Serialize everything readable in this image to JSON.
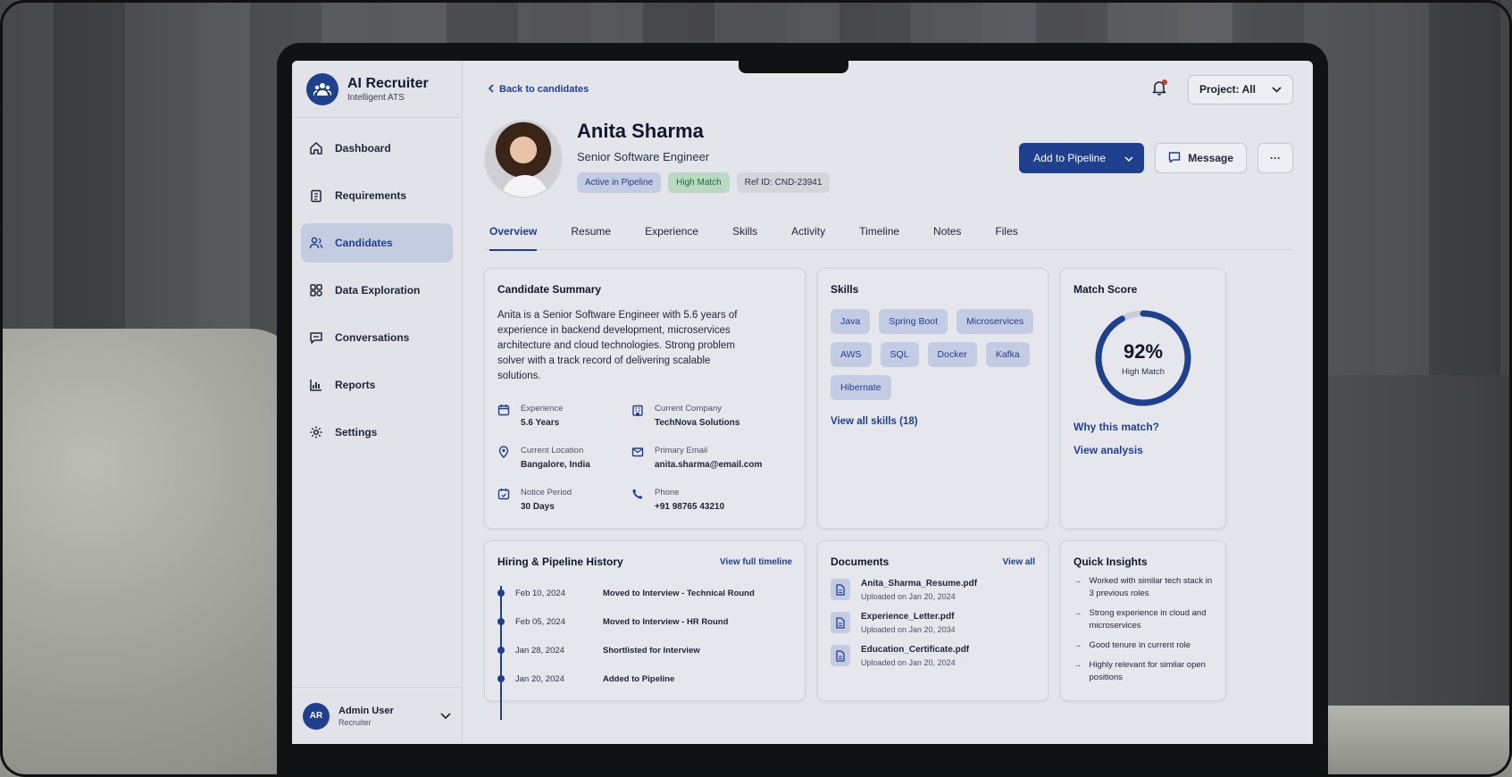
{
  "app": {
    "name": "AI Recruiter",
    "subtitle": "Intelligent ATS"
  },
  "sidebar": {
    "items": [
      {
        "label": "Dashboard",
        "icon": "home-icon"
      },
      {
        "label": "Requirements",
        "icon": "clipboard-icon"
      },
      {
        "label": "Candidates",
        "icon": "users-icon",
        "active": true
      },
      {
        "label": "Data Exploration",
        "icon": "explore-icon"
      },
      {
        "label": "Conversations",
        "icon": "chat-icon"
      },
      {
        "label": "Reports",
        "icon": "bar-chart-icon"
      },
      {
        "label": "Settings",
        "icon": "gear-icon"
      }
    ],
    "user": {
      "initials": "AR",
      "name": "Admin User",
      "role": "Recruiter"
    }
  },
  "topbar": {
    "back_label": "Back to candidates",
    "project_label": "Project: All"
  },
  "candidate": {
    "name": "Anita Sharma",
    "title": "Senior Software Engineer",
    "badges": {
      "pipeline": "Active in Pipeline",
      "match": "High Match",
      "ref": "Ref ID: CND-23941"
    },
    "actions": {
      "add_pipeline": "Add to Pipeline",
      "message": "Message",
      "more": "···"
    }
  },
  "tabs": [
    "Overview",
    "Resume",
    "Experience",
    "Skills",
    "Activity",
    "Timeline",
    "Notes",
    "Files"
  ],
  "summary": {
    "title": "Candidate Summary",
    "text": "Anita is a Senior Software Engineer with 5.6 years of experience in backend development, microservices architecture and cloud technologies. Strong problem solver with a track record of delivering scalable solutions.",
    "facts": [
      {
        "label": "Experience",
        "value": "5.6 Years",
        "icon": "calendar-icon"
      },
      {
        "label": "Current Company",
        "value": "TechNova Solutions",
        "icon": "building-icon"
      },
      {
        "label": "Current Location",
        "value": "Bangalore, India",
        "icon": "location-pin-icon"
      },
      {
        "label": "Primary Email",
        "value": "anita.sharma@email.com",
        "icon": "mail-icon"
      },
      {
        "label": "Notice Period",
        "value": "30 Days",
        "icon": "clock-calendar-icon"
      },
      {
        "label": "Phone",
        "value": "+91 98765 43210",
        "icon": "phone-icon"
      }
    ]
  },
  "skills": {
    "title": "Skills",
    "items": [
      "Java",
      "Spring Boot",
      "Microservices",
      "AWS",
      "SQL",
      "Docker",
      "Kafka",
      "Hibernate"
    ],
    "view_all": "View all skills (18)"
  },
  "match": {
    "title": "Match Score",
    "percent": 92,
    "percent_label": "92%",
    "label": "High Match",
    "why": "Why this match?",
    "analysis": "View analysis",
    "color": "#1f3f8f"
  },
  "history": {
    "title": "Hiring & Pipeline History",
    "link": "View full timeline",
    "events": [
      {
        "date": "Feb 10, 2024",
        "event": "Moved to Interview - Technical Round"
      },
      {
        "date": "Feb 05, 2024",
        "event": "Moved to Interview - HR Round"
      },
      {
        "date": "Jan 28, 2024",
        "event": "Shortlisted for Interview"
      },
      {
        "date": "Jan 20, 2024",
        "event": "Added to Pipeline"
      }
    ]
  },
  "documents": {
    "title": "Documents",
    "link": "View all",
    "items": [
      {
        "name": "Anita_Sharma_Resume.pdf",
        "date": "Uploaded on Jan 20, 2024"
      },
      {
        "name": "Experience_Letter.pdf",
        "date": "Uploaded on Jan 20, 2034"
      },
      {
        "name": "Education_Certificate.pdf",
        "date": "Uploaded on Jan 20, 2024"
      }
    ]
  },
  "insights": {
    "title": "Quick Insights",
    "items": [
      "Worked with similar tech stack in 3 previous roles",
      "Strong experience in cloud and microservices",
      "Good tenure in current role",
      "Highly relevant for similar open positions"
    ]
  }
}
